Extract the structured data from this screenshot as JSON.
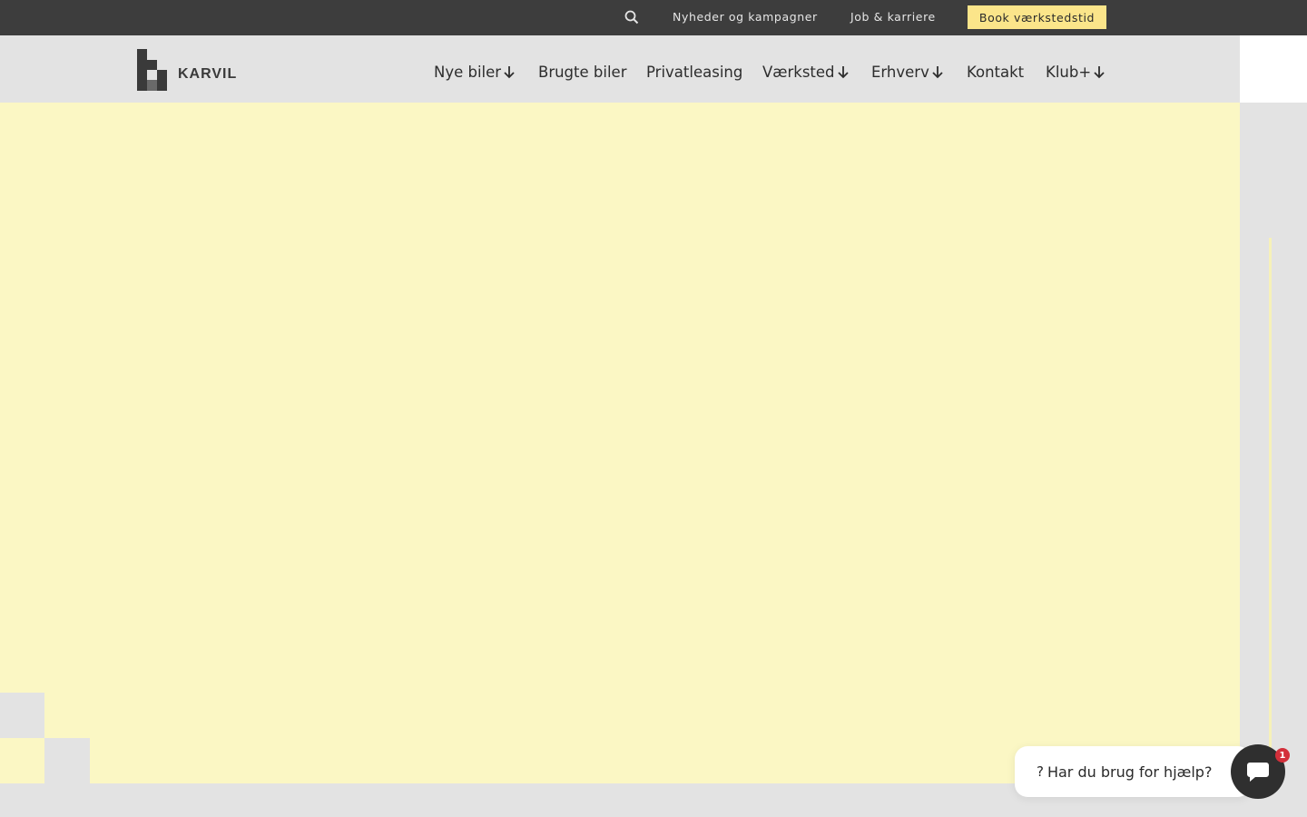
{
  "topbar": {
    "search_icon": "search-icon",
    "links": [
      "Nyheder og kampagner",
      "Job & karriere"
    ],
    "book_label": "Book værkstedstid",
    "book_color": "#fbe58a",
    "bg_color": "#3d3d3d"
  },
  "brand": {
    "name": "KARVIL"
  },
  "nav": {
    "items": [
      {
        "label": "Nye biler",
        "has_dropdown": true
      },
      {
        "label": "Brugte biler",
        "has_dropdown": false
      },
      {
        "label": "Privatleasing",
        "has_dropdown": false
      },
      {
        "label": "Værksted",
        "has_dropdown": true
      },
      {
        "label": "Erhverv",
        "has_dropdown": true
      },
      {
        "label": "Kontakt",
        "has_dropdown": false
      },
      {
        "label": "Klub+",
        "has_dropdown": true
      }
    ]
  },
  "hero": {
    "bg_color": "#fbf7c4"
  },
  "chat": {
    "prompt": "Har du brug for hjælp?",
    "prompt_icon": "question-icon",
    "button_icon": "chat-bubble-icon",
    "badge_count": "1",
    "badge_color": "#d32f3a"
  }
}
